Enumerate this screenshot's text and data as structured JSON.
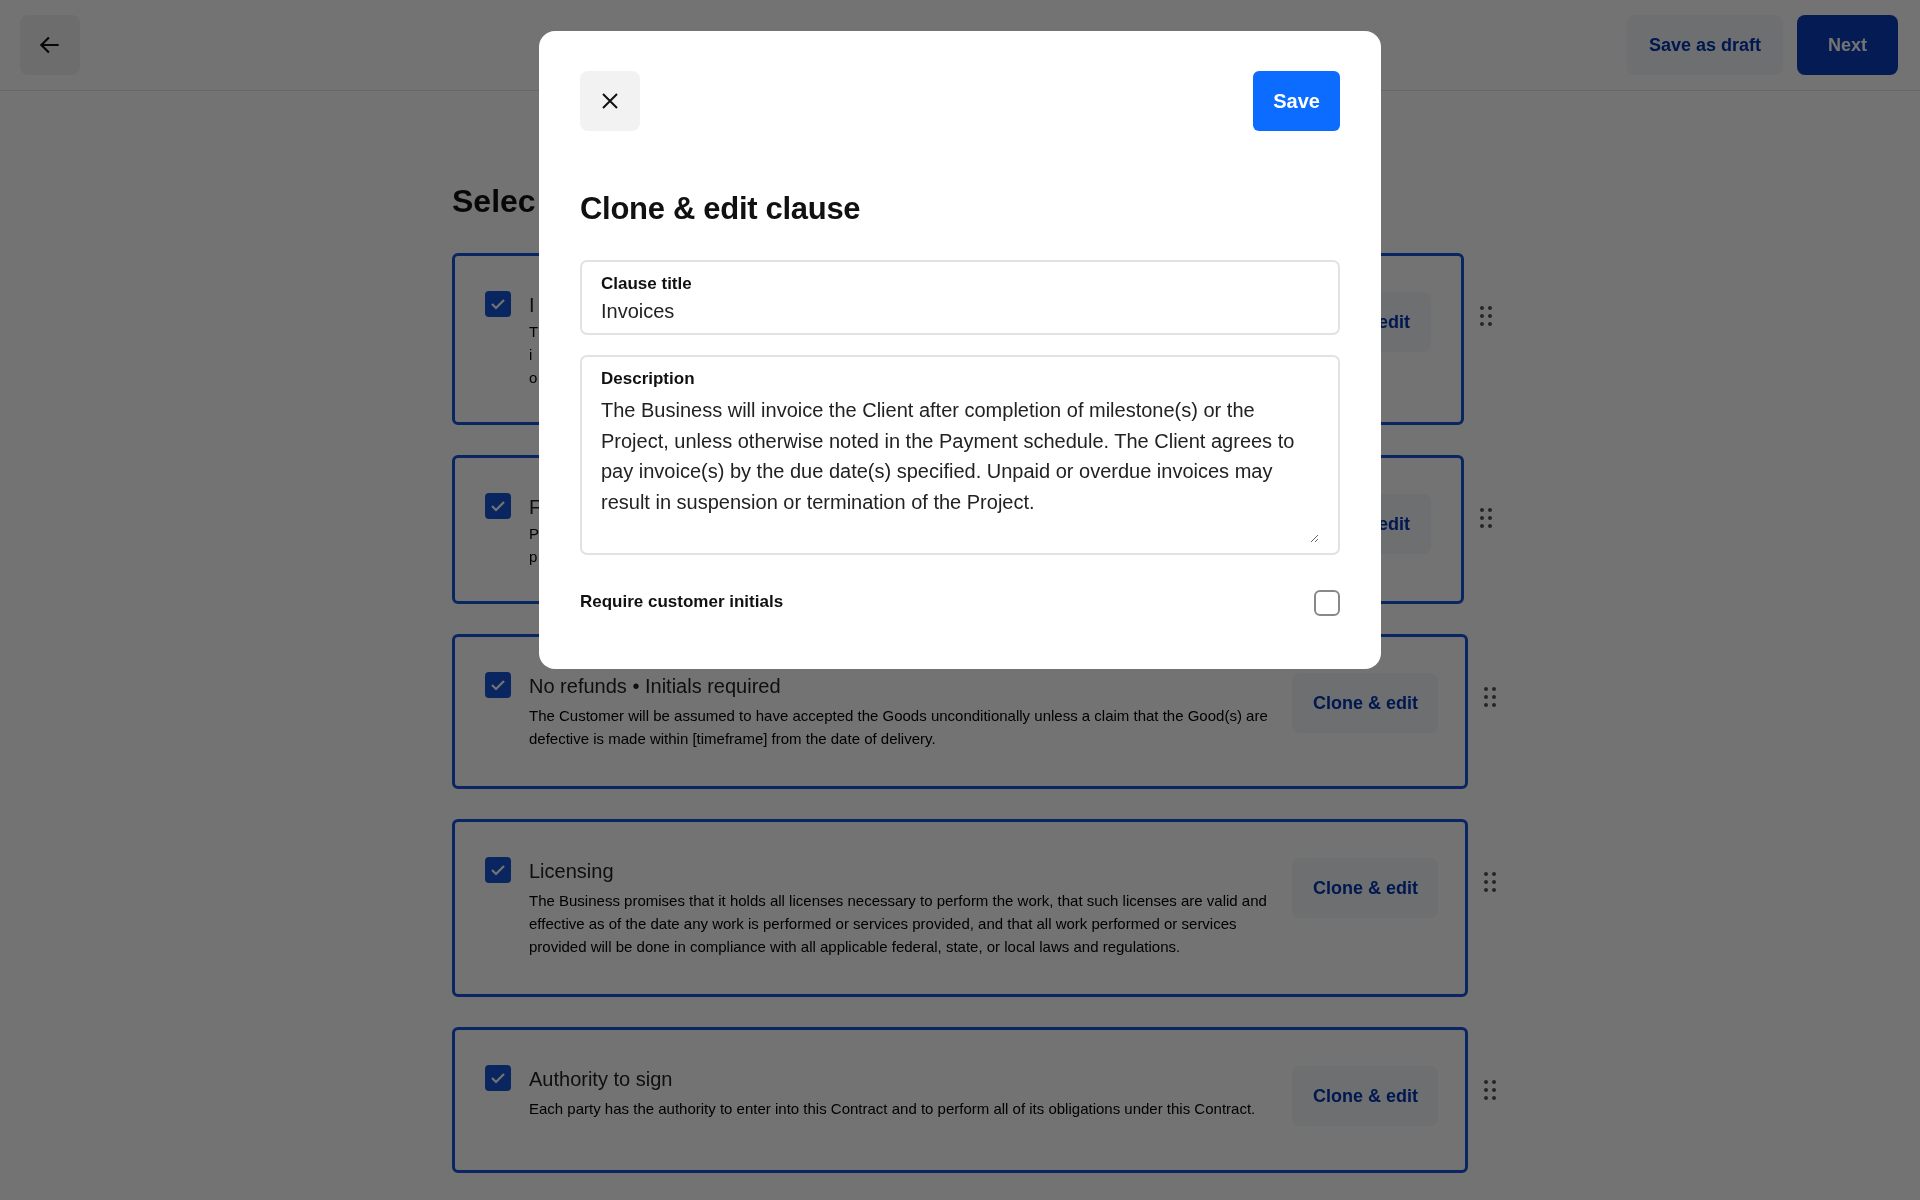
{
  "top_bar": {
    "buttons": [
      {
        "label": "Save as draft",
        "kind": "secondary"
      },
      {
        "label": "Next",
        "kind": "primary"
      }
    ]
  },
  "heading": "Selec",
  "clauses": [
    {
      "title": "I",
      "description_fragments": [
        "T",
        "i",
        "o"
      ],
      "button": "edit",
      "checked": true
    },
    {
      "title": "F",
      "description_fragments": [
        "P",
        "p"
      ],
      "button": "edit",
      "checked": true
    },
    {
      "title": "No refunds • Initials required",
      "description": "The Customer will be assumed to have accepted the Goods unconditionally unless a claim that the Good(s) are defective is made within [timeframe] from the date of delivery.",
      "button": "Clone & edit",
      "checked": true
    },
    {
      "title": "Licensing",
      "description": "The Business promises that it holds all licenses necessary to perform the work, that such licenses are valid and effective as of the date any work is performed or services provided, and that all work performed or services provided will be done in compliance with all applicable federal, state, or local laws and regulations.",
      "button": "Clone & edit",
      "checked": true
    },
    {
      "title": "Authority to sign",
      "description": "Each party has the authority to enter into this Contract and to perform all of its obligations under this Contract.",
      "button": "Clone & edit",
      "checked": true
    }
  ],
  "modal": {
    "title": "Clone & edit clause",
    "save": "Save",
    "fields": [
      {
        "label": "Clause title",
        "value": "Invoices",
        "kind": "input"
      },
      {
        "label": "Description",
        "value": "The Business will invoice the Client after completion of milestone(s) or the Project, unless otherwise noted in the Payment schedule. The Client agrees to pay invoice(s) by the due date(s) specified. Unpaid or overdue invoices may result in suspension or termination of the Project.",
        "kind": "textarea"
      }
    ],
    "require_initials": {
      "label": "Require customer initials",
      "checked": false
    }
  }
}
